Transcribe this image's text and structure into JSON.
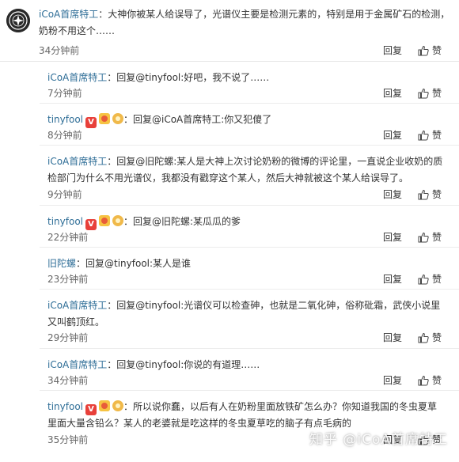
{
  "top_comment": {
    "author": "iCoA首席特工",
    "text": "：大神你被某人给误导了，光谱仪主要是检测元素的，特别是用于金属矿石的检测，奶粉不用这个……",
    "time": "34分钟前",
    "reply_label": "回复",
    "like_label": "赞"
  },
  "replies": [
    {
      "author": "iCoA首席特工",
      "text": "：回复@tinyfool:好吧，我不说了……",
      "time": "7分钟前",
      "reply_label": "回复",
      "like_label": "赞"
    },
    {
      "author": "tinyfool",
      "text": "：回复@iCoA首席特工:你又犯傻了",
      "time": "8分钟前",
      "reply_label": "回复",
      "like_label": "赞"
    },
    {
      "author": "iCoA首席特工",
      "text": "：回复@旧陀螺:某人是大神上次讨论奶粉的微博的评论里，一直说企业收奶的质检部门为什么不用光谱仪，我都没有戳穿这个某人，然后大神就被这个某人给误导了。",
      "time": "9分钟前",
      "reply_label": "回复",
      "like_label": "赞"
    },
    {
      "author": "tinyfool",
      "text": "：回复@旧陀螺:某瓜瓜的爹",
      "time": "22分钟前",
      "reply_label": "回复",
      "like_label": "赞"
    },
    {
      "author": "旧陀螺",
      "text": "：回复@tinyfool:某人是谁",
      "time": "23分钟前",
      "reply_label": "回复",
      "like_label": "赞"
    },
    {
      "author": "iCoA首席特工",
      "text": "：回复@tinyfool:光谱仪可以检查砷，也就是二氧化砷，俗称砒霜，武侠小说里又叫鹤顶红。",
      "time": "29分钟前",
      "reply_label": "回复",
      "like_label": "赞"
    },
    {
      "author": "iCoA首席特工",
      "text": "：回复@tinyfool:你说的有道理……",
      "time": "34分钟前",
      "reply_label": "回复",
      "like_label": "赞"
    },
    {
      "author": "tinyfool",
      "text": "：所以说你蠢，以后有人在奶粉里面放铁矿怎么办？你知道我国的冬虫夏草里面大量含铅么？某人的老婆就是吃这样的冬虫夏草吃的脑子有点毛病的",
      "time": "35分钟前",
      "reply_label": "回复",
      "like_label": "赞"
    }
  ],
  "badge_v_label": "V",
  "watermark": "知乎 @iCoA首席特工",
  "colors": {
    "username": "#2f6e97",
    "divider": "#e6e6e6",
    "badge_red": "#e8403a",
    "badge_gold": "#f6c343"
  },
  "icons": {
    "like": "thumbs-up-icon",
    "avatar": "logo-avatar"
  }
}
